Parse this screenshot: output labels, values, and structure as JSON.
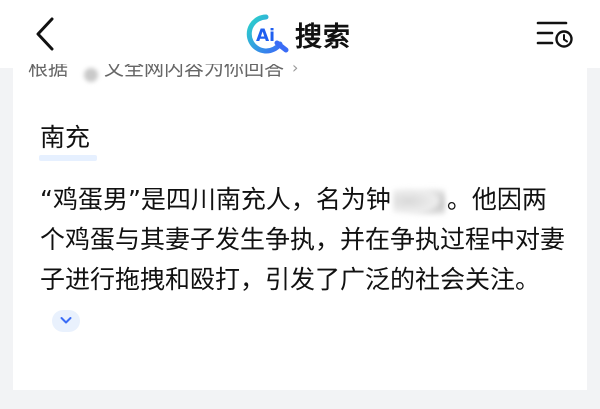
{
  "header": {
    "brand_badge": "Ai",
    "title": "搜索",
    "back_icon": "chevron-left-icon",
    "history_icon": "list-clock-icon"
  },
  "source": {
    "label": "根据",
    "text": "文全网内容为你回答"
  },
  "answer": {
    "topic": "南充",
    "text_before": "“鸡蛋男”是四川南充人，名为钟",
    "text_after": "。他因两个鸡蛋与其妻子发生争执，并在争执过程中对妻子进行拖拽和殴打，引发了广泛的社会关注。",
    "expand_icon": "chevron-down-icon"
  },
  "colors": {
    "brand_gradient_start": "#2bd4c9",
    "brand_gradient_end": "#3a6cf6",
    "accent_light": "#e9f1fd"
  }
}
